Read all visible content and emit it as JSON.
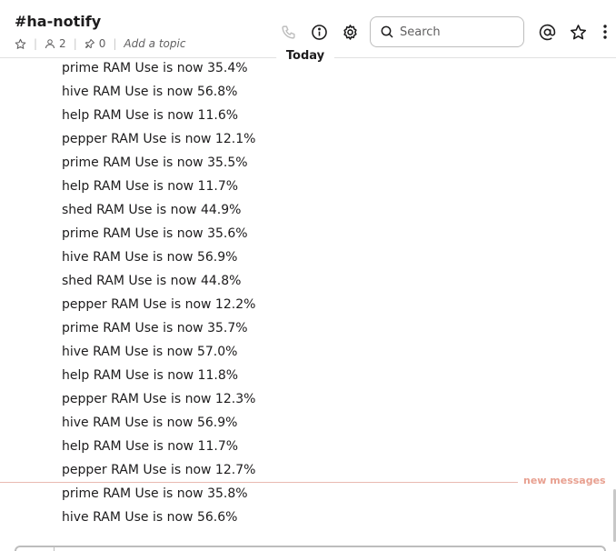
{
  "channel": {
    "title": "#ha-notify",
    "members": "2",
    "pins": "0",
    "topic": "Add a topic"
  },
  "header": {
    "search_placeholder": "Search"
  },
  "day_label": "Today",
  "messages": [
    "prime RAM Use is now 35.4%",
    "hive RAM Use is now 56.8%",
    "help RAM Use is now 11.6%",
    "pepper RAM Use is now 12.1%",
    "prime RAM Use is now 35.5%",
    "help RAM Use is now 11.7%",
    "shed RAM Use is now 44.9%",
    "prime RAM Use is now 35.6%",
    "hive RAM Use is now 56.9%",
    "shed RAM Use is now 44.8%",
    "pepper RAM Use is now 12.2%",
    "prime RAM Use is now 35.7%",
    "hive RAM Use is now 57.0%",
    "help RAM Use is now 11.8%",
    "pepper RAM Use is now 12.3%",
    "hive RAM Use is now 56.9%",
    "help RAM Use is now 11.7%",
    "pepper RAM Use is now 12.7%",
    "prime RAM Use is now 35.8%",
    "hive RAM Use is now 56.6%"
  ],
  "new_messages_label": "new messages",
  "icons": {
    "star": "star-icon",
    "member": "person-icon",
    "pin": "pin-icon",
    "call": "phone-icon",
    "details": "info-icon",
    "settings": "gear-icon",
    "search": "search-icon",
    "mentions": "at-icon",
    "saved": "star-icon",
    "more": "more-vertical-icon"
  },
  "colors": {
    "new_divider": "#e9b9b1",
    "new_label": "#e8a090",
    "text": "#1d1c1d",
    "muted": "#616061"
  }
}
